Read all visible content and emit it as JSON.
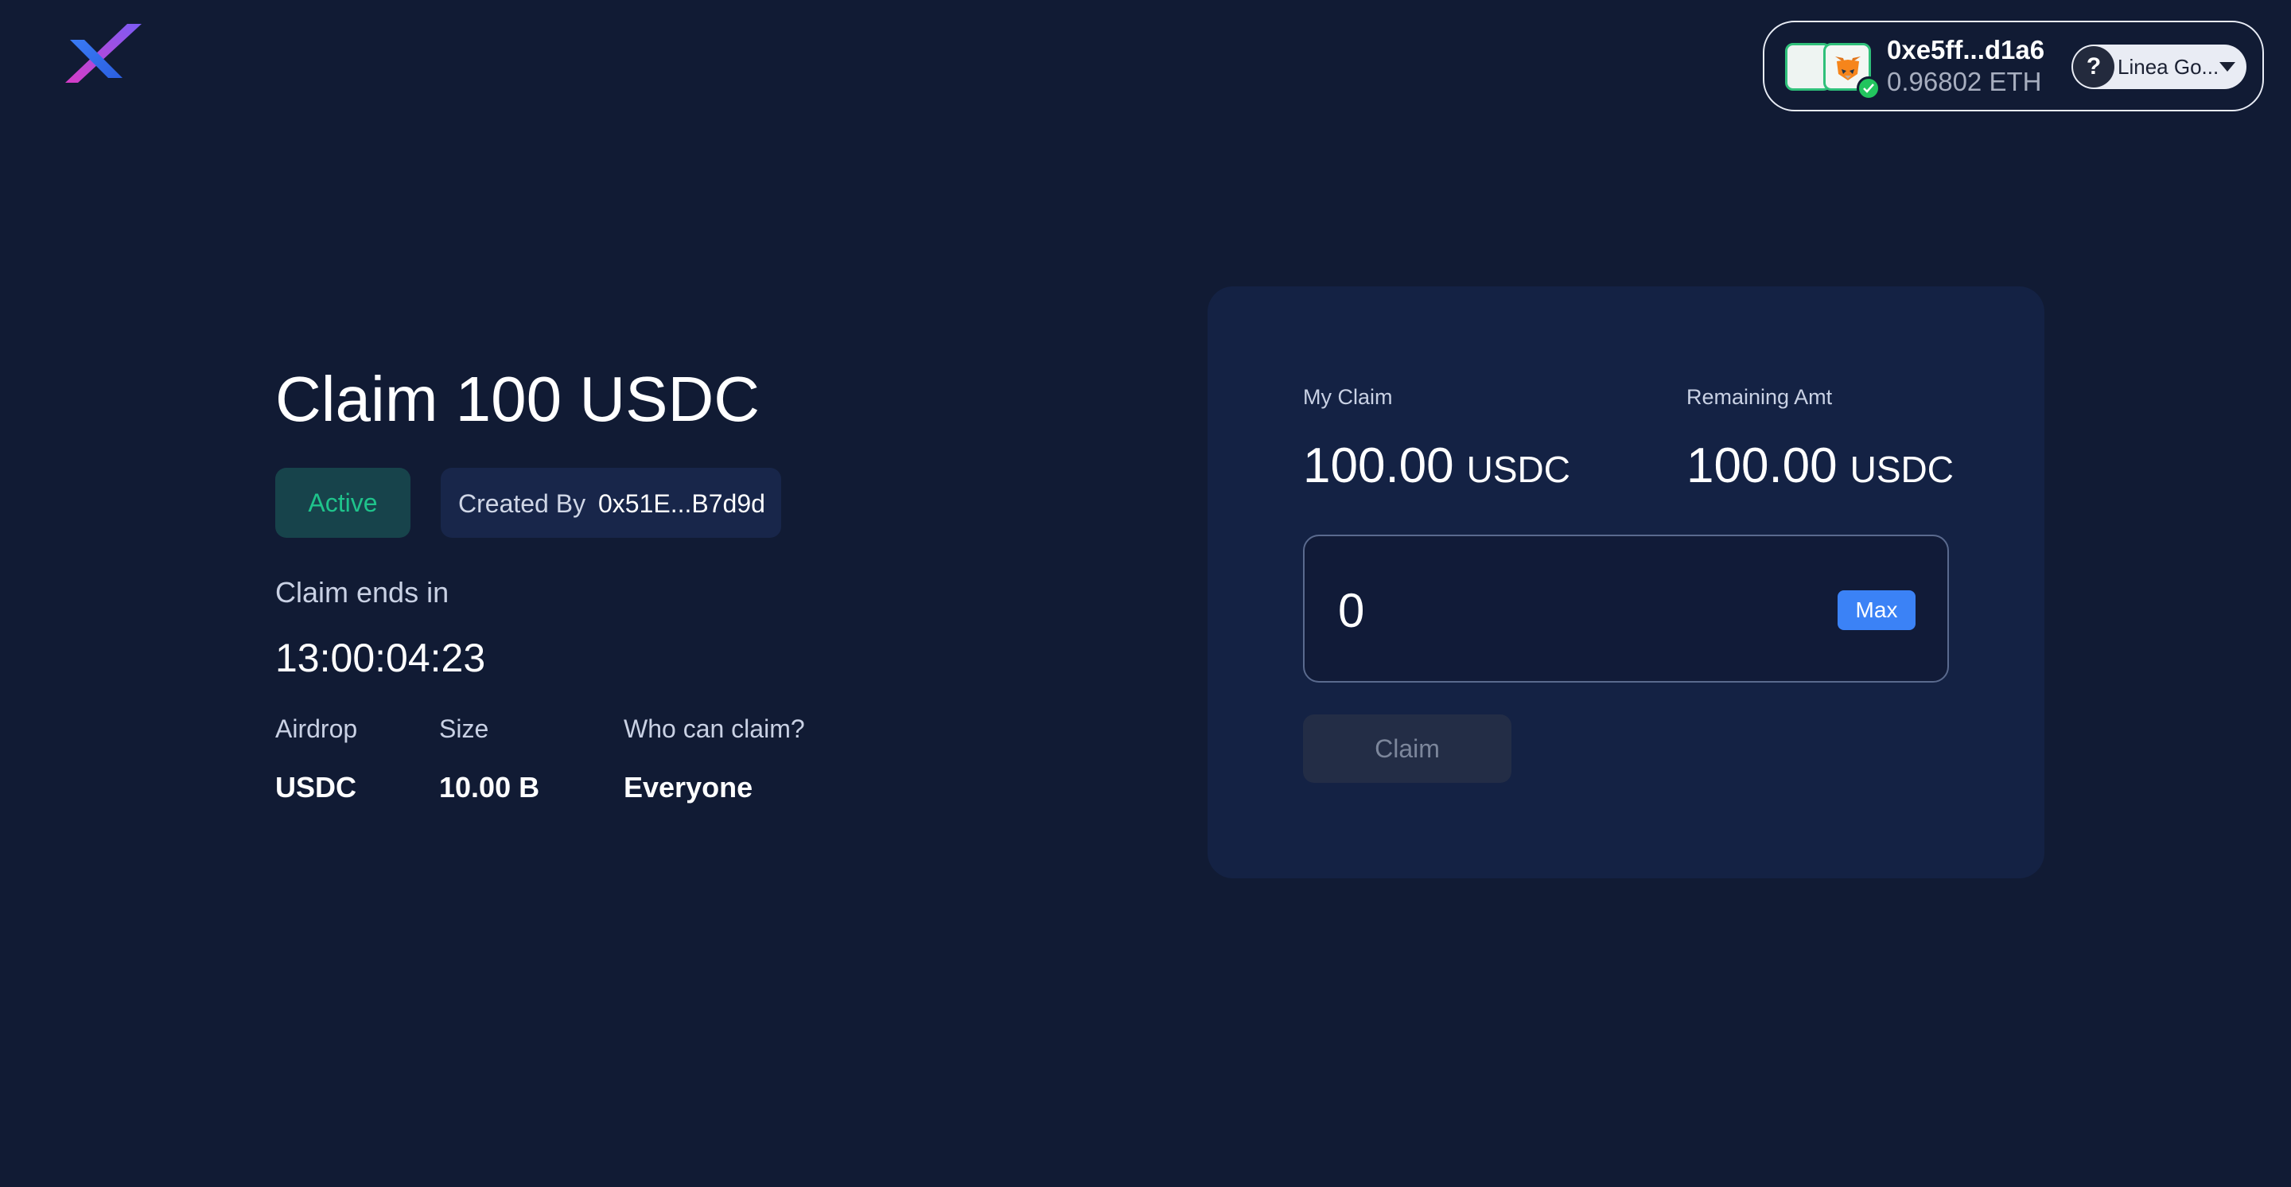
{
  "header": {
    "logo_icon": "x-logo-icon",
    "wallet": {
      "address": "0xe5ff...d1a6",
      "balance": "0.96802 ETH",
      "wallet_icon": "metamask-fox-icon",
      "verified_icon": "check-icon",
      "network": {
        "icon": "question-icon",
        "icon_text": "?",
        "label": "Linea Go..."
      }
    }
  },
  "airdrop": {
    "title": "Claim 100 USDC",
    "status": "Active",
    "created_by_label": "Created By",
    "creator_address": "0x51E...B7d9d",
    "ends_label": "Claim ends in",
    "countdown": "13:00:04:23",
    "details": [
      {
        "label": "Airdrop",
        "value": "USDC"
      },
      {
        "label": "Size",
        "value": "10.00 B"
      },
      {
        "label": "Who can claim?",
        "value": "Everyone"
      }
    ]
  },
  "claim_card": {
    "my_claim": {
      "label": "My Claim",
      "amount": "100.00",
      "unit": "USDC"
    },
    "remaining": {
      "label": "Remaining Amt",
      "amount": "100.00",
      "unit": "USDC"
    },
    "amount_input_value": "0",
    "max_label": "Max",
    "claim_label": "Claim"
  },
  "colors": {
    "background": "#111b34",
    "card": "#142244",
    "accent": "#3b82f6",
    "active_green": "#1fc38b"
  }
}
